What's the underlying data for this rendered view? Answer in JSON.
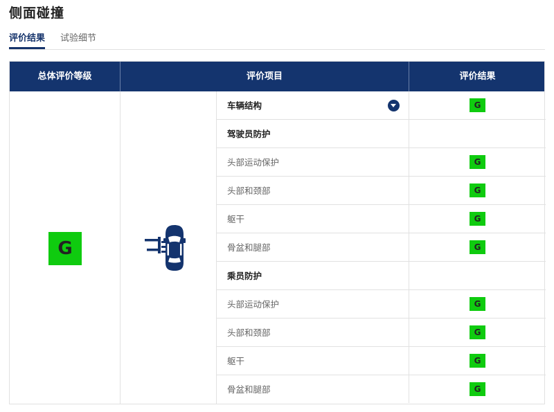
{
  "page": {
    "title": "侧面碰撞"
  },
  "tabs": [
    {
      "label": "评价结果",
      "active": true
    },
    {
      "label": "试验细节",
      "active": false
    }
  ],
  "table": {
    "headers": [
      "总体评价等级",
      "评价项目",
      "评价结果"
    ],
    "overall_rating": "G",
    "rating_color": "#0fcb0f",
    "header_color": "#14346e",
    "rows": [
      {
        "label": "车辆结构",
        "rating": "G",
        "style": "bold",
        "has_dropdown": true
      },
      {
        "label": "驾驶员防护",
        "rating": "",
        "style": "section"
      },
      {
        "label": "头部运动保护",
        "rating": "G",
        "style": "normal"
      },
      {
        "label": "头部和颈部",
        "rating": "G",
        "style": "normal"
      },
      {
        "label": "躯干",
        "rating": "G",
        "style": "normal"
      },
      {
        "label": "骨盆和腿部",
        "rating": "G",
        "style": "normal"
      },
      {
        "label": "乘员防护",
        "rating": "",
        "style": "section"
      },
      {
        "label": "头部运动保护",
        "rating": "G",
        "style": "normal"
      },
      {
        "label": "头部和颈部",
        "rating": "G",
        "style": "normal"
      },
      {
        "label": "躯干",
        "rating": "G",
        "style": "normal"
      },
      {
        "label": "骨盆和腿部",
        "rating": "G",
        "style": "normal"
      }
    ]
  },
  "icons": {
    "dropdown": "chevron-down-circle-icon",
    "test_diagram": "side-impact-car-icon"
  }
}
